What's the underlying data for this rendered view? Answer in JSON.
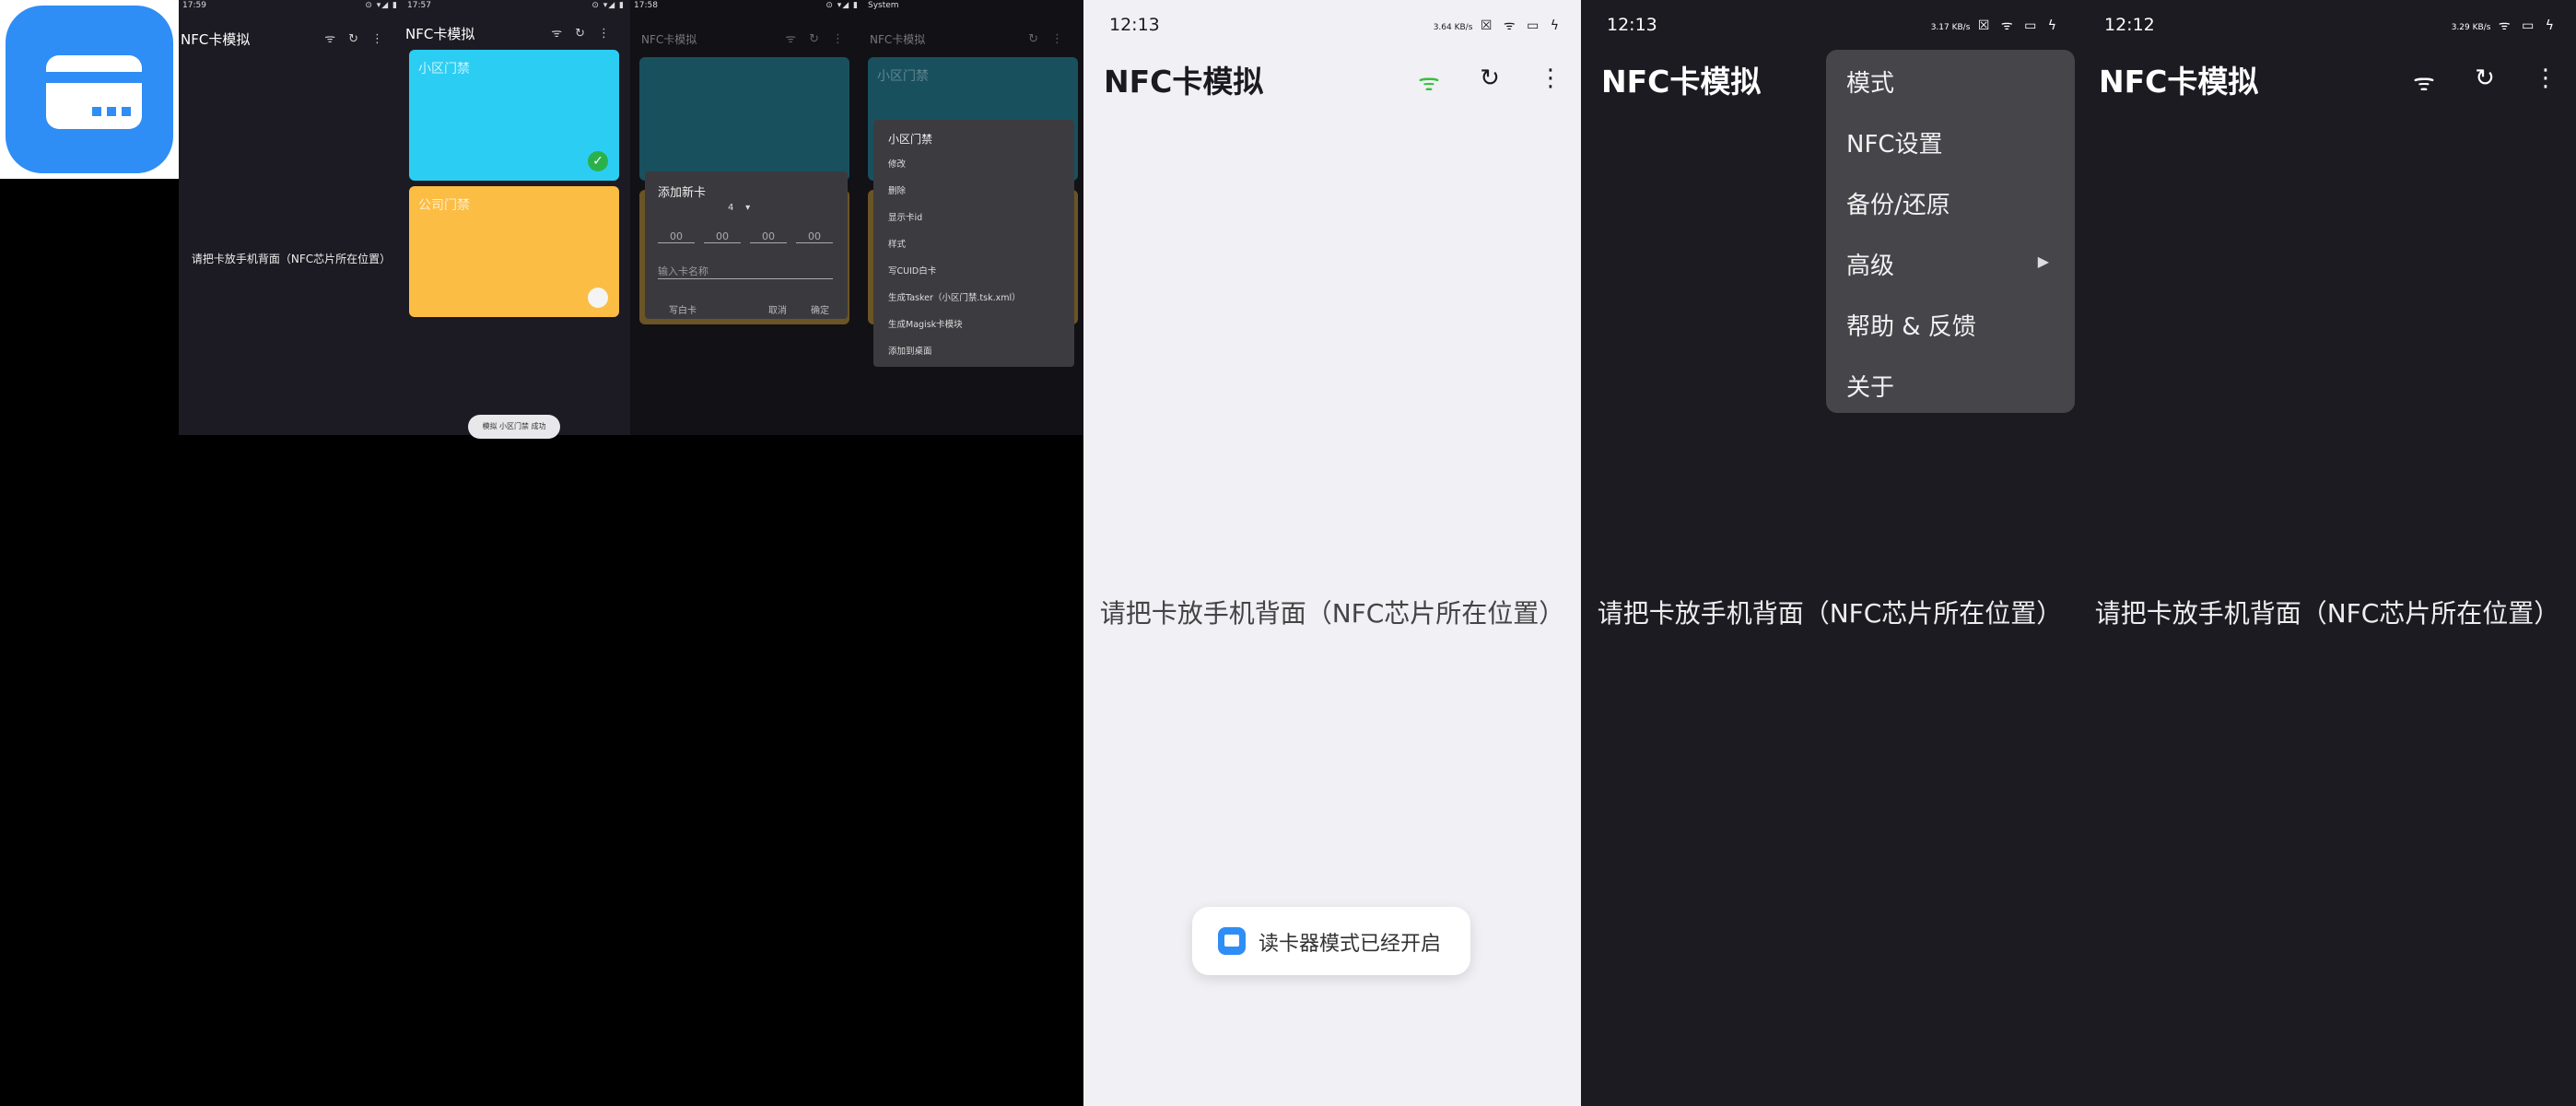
{
  "app_icon": {
    "name": "card-icon"
  },
  "mini1": {
    "status_time": "17:59",
    "status_icons": "⊙ ▾◢ ▮",
    "title": "NFC卡模拟",
    "hint": "请把卡放手机背面（NFC芯片所在位置）"
  },
  "mini2": {
    "status_time": "17:57",
    "status_icons": "⊙ ▾◢ ▮",
    "title": "NFC卡模拟",
    "cards": [
      {
        "name": "小区门禁",
        "color": "#2ccdf2"
      },
      {
        "name": "公司门禁",
        "color": "#fcbd44"
      }
    ],
    "toast": "模拟 小区门禁 成功"
  },
  "mini3": {
    "status_time": "17:58",
    "status_icons": "⊙ ▾◢ ▮",
    "title": "NFC卡模拟",
    "dialog": {
      "title": "添加新卡",
      "length": "4",
      "hex": [
        "00",
        "00",
        "00",
        "00"
      ],
      "name_placeholder": "输入卡名称",
      "btn_write": "写白卡",
      "btn_cancel": "取消",
      "btn_ok": "确定"
    }
  },
  "mini4": {
    "status_time": "System",
    "title": "NFC卡模拟",
    "card_name": "小区门禁",
    "context": {
      "title": "小区门禁",
      "items": [
        "修改",
        "删除",
        "显示卡id",
        "样式",
        "写CUID白卡",
        "生成Tasker（小区门禁.tsk.xml）",
        "生成Magisk卡模块",
        "添加到桌面"
      ]
    }
  },
  "screen1": {
    "time": "12:13",
    "net_speed": "3.64 KB/s",
    "title": "NFC卡模拟",
    "hint": "请把卡放手机背面（NFC芯片所在位置）",
    "toast": "读卡器模式已经开启"
  },
  "screen2": {
    "time": "12:13",
    "net_speed": "3.17 KB/s",
    "title": "NFC卡模拟",
    "hint": "请把卡放手机背面（NFC芯片所在位置）",
    "menu": [
      "模式",
      "NFC设置",
      "备份/还原",
      "高级",
      "帮助 & 反馈",
      "关于"
    ]
  },
  "screen3": {
    "time": "12:12",
    "net_speed": "3.29 KB/s",
    "title": "NFC卡模拟",
    "hint": "请把卡放手机背面（NFC芯片所在位置）"
  },
  "colors": {
    "accent": "#2f8df6",
    "nfc_active": "#35c23a"
  }
}
